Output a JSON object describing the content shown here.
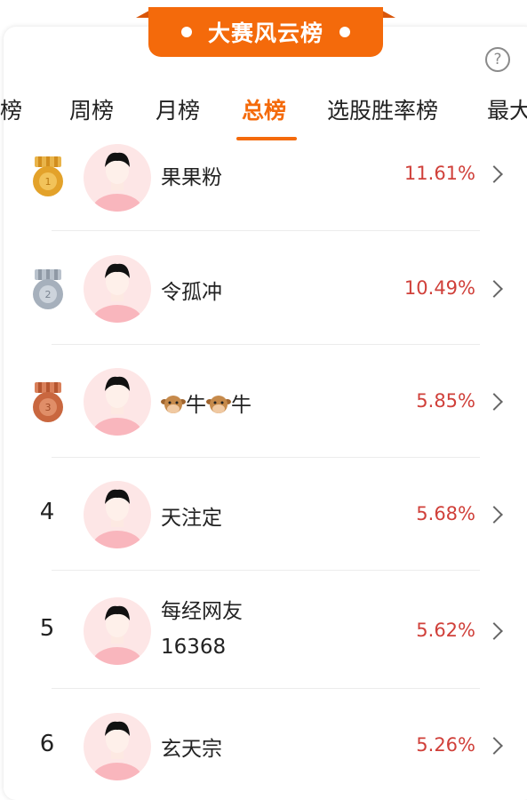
{
  "banner": {
    "title": "大赛风云榜"
  },
  "help_symbol": "?",
  "tabs": [
    {
      "label": "日榜",
      "active": false
    },
    {
      "label": "周榜",
      "active": false
    },
    {
      "label": "月榜",
      "active": false
    },
    {
      "label": "总榜",
      "active": true
    },
    {
      "label": "选股胜率榜",
      "active": false
    },
    {
      "label": "最大",
      "active": false
    }
  ],
  "rows": [
    {
      "rank": "1",
      "medal": "gold",
      "name": "果果粉",
      "rate": "11.61%"
    },
    {
      "rank": "2",
      "medal": "silver",
      "name": "令孤冲",
      "rate": "10.49%"
    },
    {
      "rank": "3",
      "medal": "bronze",
      "name_parts": [
        "牛",
        "牛"
      ],
      "name_icon": "cow-emoji-icon",
      "rate": "5.85%"
    },
    {
      "rank": "4",
      "name": "天注定",
      "rate": "5.68%"
    },
    {
      "rank": "5",
      "name_line1": "每经网友",
      "name_line2": "16368",
      "rate": "5.62%"
    },
    {
      "rank": "6",
      "name": "玄天宗",
      "rate": "5.26%"
    }
  ],
  "colors": {
    "accent": "#f46a0b",
    "rate": "#d0403a",
    "medal_gold": "#e3a22a",
    "medal_silver": "#a6b0bc",
    "medal_bronze": "#c9673f",
    "avatar_bg": "#fde6e6"
  }
}
